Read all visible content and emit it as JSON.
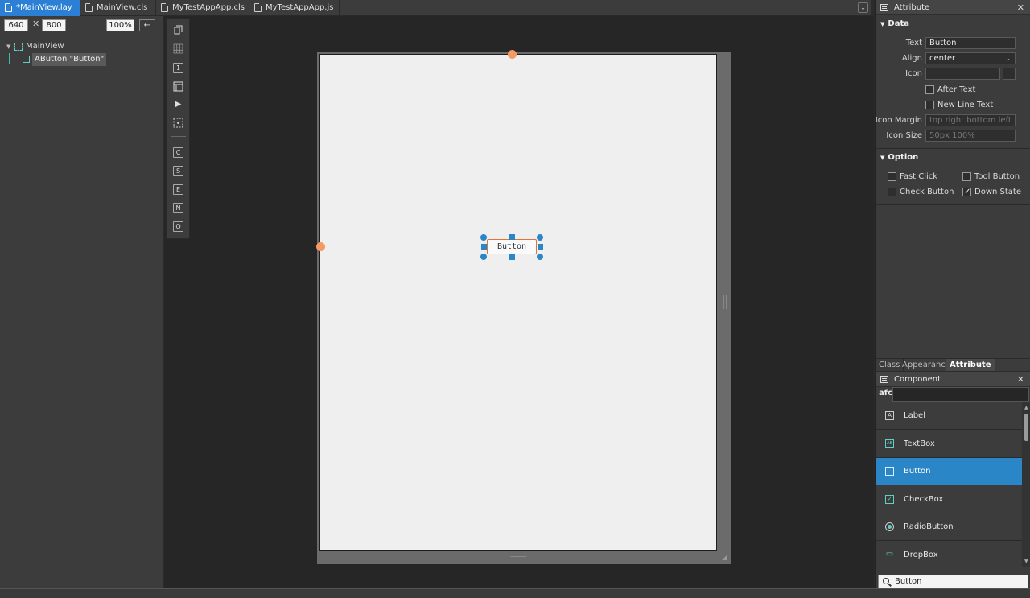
{
  "tabs": [
    {
      "label": "*MainView.lay",
      "active": true
    },
    {
      "label": "MainView.cls",
      "active": false
    },
    {
      "label": "MyTestAppApp.cls",
      "active": false
    },
    {
      "label": "MyTestAppApp.js",
      "active": false
    }
  ],
  "tab_menu_glyph": "⌄",
  "outline": {
    "width": "640",
    "height": "800",
    "times": "✕",
    "zoom": "100%",
    "back_glyph": "←",
    "root": "MainView",
    "child": "AButton \"Button\""
  },
  "toolbar_letters": [
    "C",
    "S",
    "E",
    "N",
    "Q"
  ],
  "toolbar_glyphs": [
    "1",
    "▶"
  ],
  "canvas": {
    "button_text": "Button"
  },
  "attribute": {
    "title": "Attribute",
    "close": "✕",
    "data_section": "Data",
    "fields": {
      "text_label": "Text",
      "text_value": "Button",
      "align_label": "Align",
      "align_value": "center",
      "icon_label": "Icon",
      "icon_value": "",
      "after_text": "After Text",
      "new_line_text": "New Line Text",
      "icon_margin_label": "Icon Margin",
      "icon_margin_placeholder": "top right bottom left",
      "icon_size_label": "Icon Size",
      "icon_size_placeholder": "50px 100%"
    },
    "option_section": "Option",
    "options": {
      "fast_click": "Fast Click",
      "tool_button": "Tool Button",
      "check_button": "Check Button",
      "down_state": "Down State",
      "down_state_checked": true
    },
    "bottom_tabs": [
      "Class",
      "Appearance",
      "Attribute"
    ]
  },
  "component": {
    "title": "Component",
    "close": "✕",
    "library": "afc",
    "items": [
      {
        "label": "Label",
        "icon": "label-icon",
        "glyph": "A"
      },
      {
        "label": "TextBox",
        "icon": "textbox-icon",
        "glyph": "AB"
      },
      {
        "label": "Button",
        "icon": "button-icon",
        "glyph": "",
        "selected": true
      },
      {
        "label": "CheckBox",
        "icon": "checkbox-icon",
        "glyph": "✓"
      },
      {
        "label": "RadioButton",
        "icon": "radio-icon",
        "glyph": ""
      },
      {
        "label": "DropBox",
        "icon": "dropbox-icon",
        "glyph": "▭"
      }
    ],
    "search_value": "Button"
  }
}
